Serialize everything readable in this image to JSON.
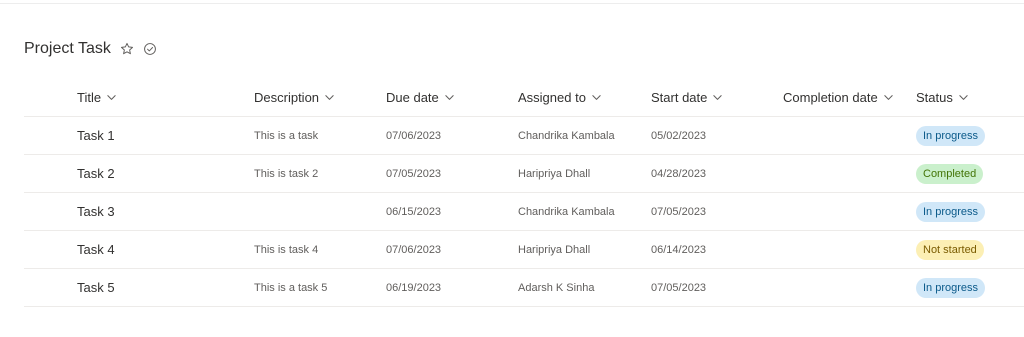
{
  "page": {
    "title": "Project Task"
  },
  "columns": [
    "Title",
    "Description",
    "Due date",
    "Assigned to",
    "Start date",
    "Completion date",
    "Status"
  ],
  "rows": [
    {
      "title": "Task 1",
      "description": "This is a task",
      "due": "07/06/2023",
      "assigned": "Chandrika Kambala",
      "start": "05/02/2023",
      "completion": "",
      "status": "In progress"
    },
    {
      "title": "Task 2",
      "description": "This is task 2",
      "due": "07/05/2023",
      "assigned": "Haripriya Dhall",
      "start": "04/28/2023",
      "completion": "",
      "status": "Completed"
    },
    {
      "title": "Task 3",
      "description": "",
      "due": "06/15/2023",
      "assigned": "Chandrika Kambala",
      "start": "07/05/2023",
      "completion": "",
      "status": "In progress"
    },
    {
      "title": "Task 4",
      "description": "This is task 4",
      "due": "07/06/2023",
      "assigned": "Haripriya Dhall",
      "start": "06/14/2023",
      "completion": "",
      "status": "Not started"
    },
    {
      "title": "Task 5",
      "description": "This is a task 5",
      "due": "06/19/2023",
      "assigned": "Adarsh K Sinha",
      "start": "07/05/2023",
      "completion": "",
      "status": "In progress"
    }
  ],
  "status_colors": {
    "In progress": {
      "bg": "#d0e7f8",
      "fg": "#0b5a8a"
    },
    "Completed": {
      "bg": "#caf0cc",
      "fg": "#437406"
    },
    "Not started": {
      "bg": "#fcefb4",
      "fg": "#7a5b00"
    }
  },
  "icons": {
    "favorite": "star-outline-icon",
    "follow": "check-circle-icon",
    "sort": "chevron-down-icon"
  }
}
